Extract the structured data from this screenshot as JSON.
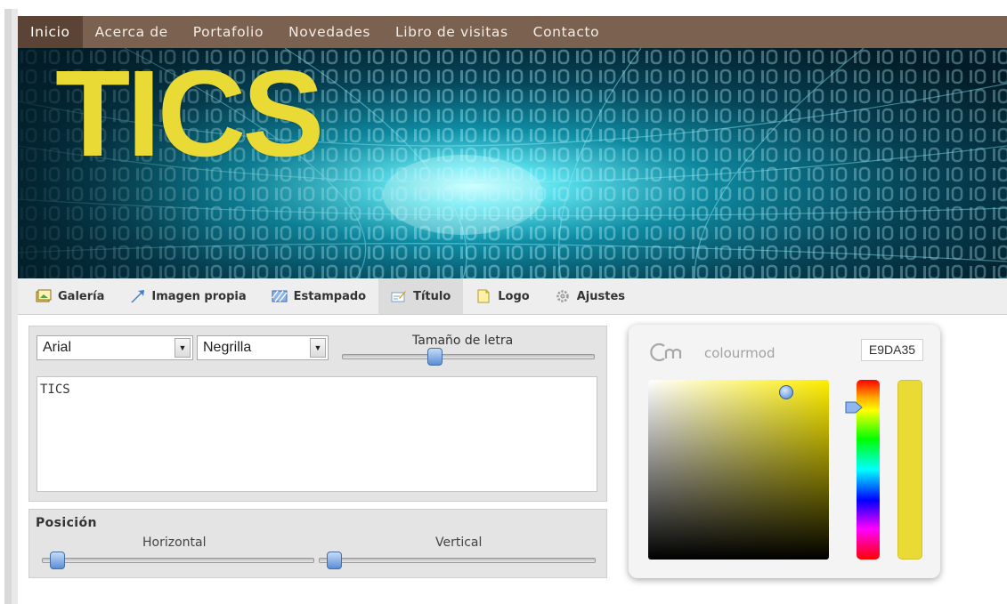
{
  "nav": {
    "items": [
      {
        "label": "Inicio",
        "active": true
      },
      {
        "label": "Acerca de",
        "active": false
      },
      {
        "label": "Portafolio",
        "active": false
      },
      {
        "label": "Novedades",
        "active": false
      },
      {
        "label": "Libro de visitas",
        "active": false
      },
      {
        "label": "Contacto",
        "active": false
      }
    ],
    "bar_color": "#7a6150"
  },
  "banner": {
    "title": "TICS",
    "title_color": "#e9da35",
    "image": "binary-code-tunnel"
  },
  "toolbar": {
    "tabs": [
      {
        "label": "Galería",
        "icon": "gallery-icon",
        "active": false
      },
      {
        "label": "Imagen propia",
        "icon": "upload-image-icon",
        "active": false
      },
      {
        "label": "Estampado",
        "icon": "pattern-icon",
        "active": false
      },
      {
        "label": "Título",
        "icon": "title-edit-icon",
        "active": true
      },
      {
        "label": "Logo",
        "icon": "logo-icon",
        "active": false
      },
      {
        "label": "Ajustes",
        "icon": "settings-gear-icon",
        "active": false
      }
    ]
  },
  "editor": {
    "font": "Arial",
    "weight": "Negrilla",
    "size_label": "Tamaño de letra",
    "size_slider_value": 0.36,
    "text": "TICS"
  },
  "position": {
    "heading": "Posición",
    "horizontal_label": "Horizontal",
    "vertical_label": "Vertical",
    "horizontal_value": 0.03,
    "vertical_value": 0.03
  },
  "color_picker": {
    "name": "colourmod",
    "hex": "E9DA35",
    "color": "#e9da35"
  }
}
